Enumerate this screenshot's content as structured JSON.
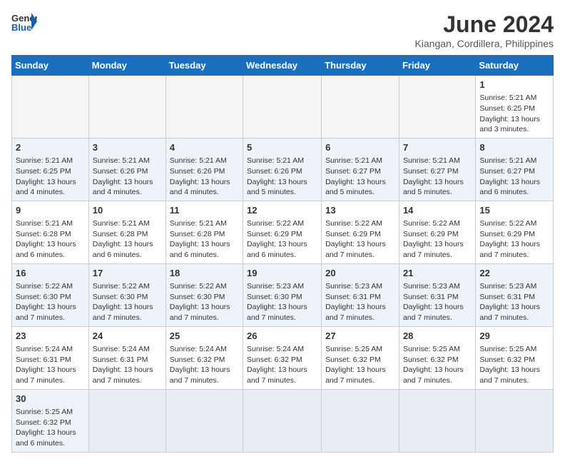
{
  "header": {
    "logo_general": "General",
    "logo_blue": "Blue",
    "title": "June 2024",
    "subtitle": "Kiangan, Cordillera, Philippines"
  },
  "weekdays": [
    "Sunday",
    "Monday",
    "Tuesday",
    "Wednesday",
    "Thursday",
    "Friday",
    "Saturday"
  ],
  "weeks": [
    [
      {
        "day": "",
        "info": "",
        "empty": true
      },
      {
        "day": "",
        "info": "",
        "empty": true
      },
      {
        "day": "",
        "info": "",
        "empty": true
      },
      {
        "day": "",
        "info": "",
        "empty": true
      },
      {
        "day": "",
        "info": "",
        "empty": true
      },
      {
        "day": "",
        "info": "",
        "empty": true
      },
      {
        "day": "1",
        "info": "Sunrise: 5:21 AM\nSunset: 6:25 PM\nDaylight: 13 hours and 3 minutes."
      }
    ],
    [
      {
        "day": "2",
        "info": "Sunrise: 5:21 AM\nSunset: 6:25 PM\nDaylight: 13 hours and 4 minutes."
      },
      {
        "day": "3",
        "info": "Sunrise: 5:21 AM\nSunset: 6:26 PM\nDaylight: 13 hours and 4 minutes."
      },
      {
        "day": "4",
        "info": "Sunrise: 5:21 AM\nSunset: 6:26 PM\nDaylight: 13 hours and 4 minutes."
      },
      {
        "day": "5",
        "info": "Sunrise: 5:21 AM\nSunset: 6:26 PM\nDaylight: 13 hours and 5 minutes."
      },
      {
        "day": "6",
        "info": "Sunrise: 5:21 AM\nSunset: 6:27 PM\nDaylight: 13 hours and 5 minutes."
      },
      {
        "day": "7",
        "info": "Sunrise: 5:21 AM\nSunset: 6:27 PM\nDaylight: 13 hours and 5 minutes."
      },
      {
        "day": "8",
        "info": "Sunrise: 5:21 AM\nSunset: 6:27 PM\nDaylight: 13 hours and 6 minutes."
      }
    ],
    [
      {
        "day": "9",
        "info": "Sunrise: 5:21 AM\nSunset: 6:28 PM\nDaylight: 13 hours and 6 minutes."
      },
      {
        "day": "10",
        "info": "Sunrise: 5:21 AM\nSunset: 6:28 PM\nDaylight: 13 hours and 6 minutes."
      },
      {
        "day": "11",
        "info": "Sunrise: 5:21 AM\nSunset: 6:28 PM\nDaylight: 13 hours and 6 minutes."
      },
      {
        "day": "12",
        "info": "Sunrise: 5:22 AM\nSunset: 6:29 PM\nDaylight: 13 hours and 6 minutes."
      },
      {
        "day": "13",
        "info": "Sunrise: 5:22 AM\nSunset: 6:29 PM\nDaylight: 13 hours and 7 minutes."
      },
      {
        "day": "14",
        "info": "Sunrise: 5:22 AM\nSunset: 6:29 PM\nDaylight: 13 hours and 7 minutes."
      },
      {
        "day": "15",
        "info": "Sunrise: 5:22 AM\nSunset: 6:29 PM\nDaylight: 13 hours and 7 minutes."
      }
    ],
    [
      {
        "day": "16",
        "info": "Sunrise: 5:22 AM\nSunset: 6:30 PM\nDaylight: 13 hours and 7 minutes."
      },
      {
        "day": "17",
        "info": "Sunrise: 5:22 AM\nSunset: 6:30 PM\nDaylight: 13 hours and 7 minutes."
      },
      {
        "day": "18",
        "info": "Sunrise: 5:22 AM\nSunset: 6:30 PM\nDaylight: 13 hours and 7 minutes."
      },
      {
        "day": "19",
        "info": "Sunrise: 5:23 AM\nSunset: 6:30 PM\nDaylight: 13 hours and 7 minutes."
      },
      {
        "day": "20",
        "info": "Sunrise: 5:23 AM\nSunset: 6:31 PM\nDaylight: 13 hours and 7 minutes."
      },
      {
        "day": "21",
        "info": "Sunrise: 5:23 AM\nSunset: 6:31 PM\nDaylight: 13 hours and 7 minutes."
      },
      {
        "day": "22",
        "info": "Sunrise: 5:23 AM\nSunset: 6:31 PM\nDaylight: 13 hours and 7 minutes."
      }
    ],
    [
      {
        "day": "23",
        "info": "Sunrise: 5:24 AM\nSunset: 6:31 PM\nDaylight: 13 hours and 7 minutes."
      },
      {
        "day": "24",
        "info": "Sunrise: 5:24 AM\nSunset: 6:31 PM\nDaylight: 13 hours and 7 minutes."
      },
      {
        "day": "25",
        "info": "Sunrise: 5:24 AM\nSunset: 6:32 PM\nDaylight: 13 hours and 7 minutes."
      },
      {
        "day": "26",
        "info": "Sunrise: 5:24 AM\nSunset: 6:32 PM\nDaylight: 13 hours and 7 minutes."
      },
      {
        "day": "27",
        "info": "Sunrise: 5:25 AM\nSunset: 6:32 PM\nDaylight: 13 hours and 7 minutes."
      },
      {
        "day": "28",
        "info": "Sunrise: 5:25 AM\nSunset: 6:32 PM\nDaylight: 13 hours and 7 minutes."
      },
      {
        "day": "29",
        "info": "Sunrise: 5:25 AM\nSunset: 6:32 PM\nDaylight: 13 hours and 7 minutes."
      }
    ],
    [
      {
        "day": "30",
        "info": "Sunrise: 5:25 AM\nSunset: 6:32 PM\nDaylight: 13 hours and 6 minutes."
      },
      {
        "day": "",
        "info": "",
        "empty": true
      },
      {
        "day": "",
        "info": "",
        "empty": true
      },
      {
        "day": "",
        "info": "",
        "empty": true
      },
      {
        "day": "",
        "info": "",
        "empty": true
      },
      {
        "day": "",
        "info": "",
        "empty": true
      },
      {
        "day": "",
        "info": "",
        "empty": true
      }
    ]
  ]
}
